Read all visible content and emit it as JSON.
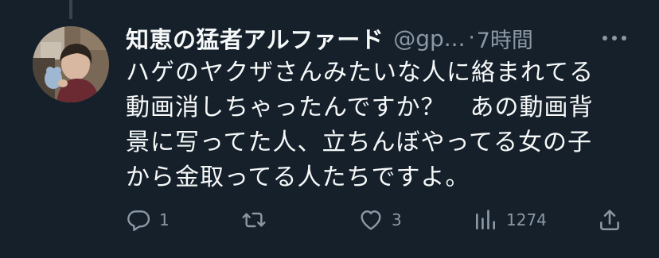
{
  "tweet": {
    "display_name": "知恵の猛者アルファード",
    "handle": "@gp...",
    "separator": "·",
    "time": "7時間",
    "text_lines": [
      "ハゲのヤクザさんみたいな人に絡まれてる",
      "動画消しちゃったんですか？　あの動画背",
      "景に写ってた人、立ちんぼやってる女の子",
      "から金取ってる人たちですよ。"
    ]
  },
  "actions": {
    "reply_count": "1",
    "retweet_count": "",
    "like_count": "3",
    "views_count": "1274"
  },
  "icons": {
    "more": "more-horizontal-icon",
    "reply": "reply-icon",
    "retweet": "retweet-icon",
    "like": "heart-icon",
    "views": "views-chart-icon",
    "share": "share-icon"
  },
  "colors": {
    "background": "#15202b",
    "primary_text": "#f7f9f9",
    "secondary_text": "#8b98a5"
  }
}
